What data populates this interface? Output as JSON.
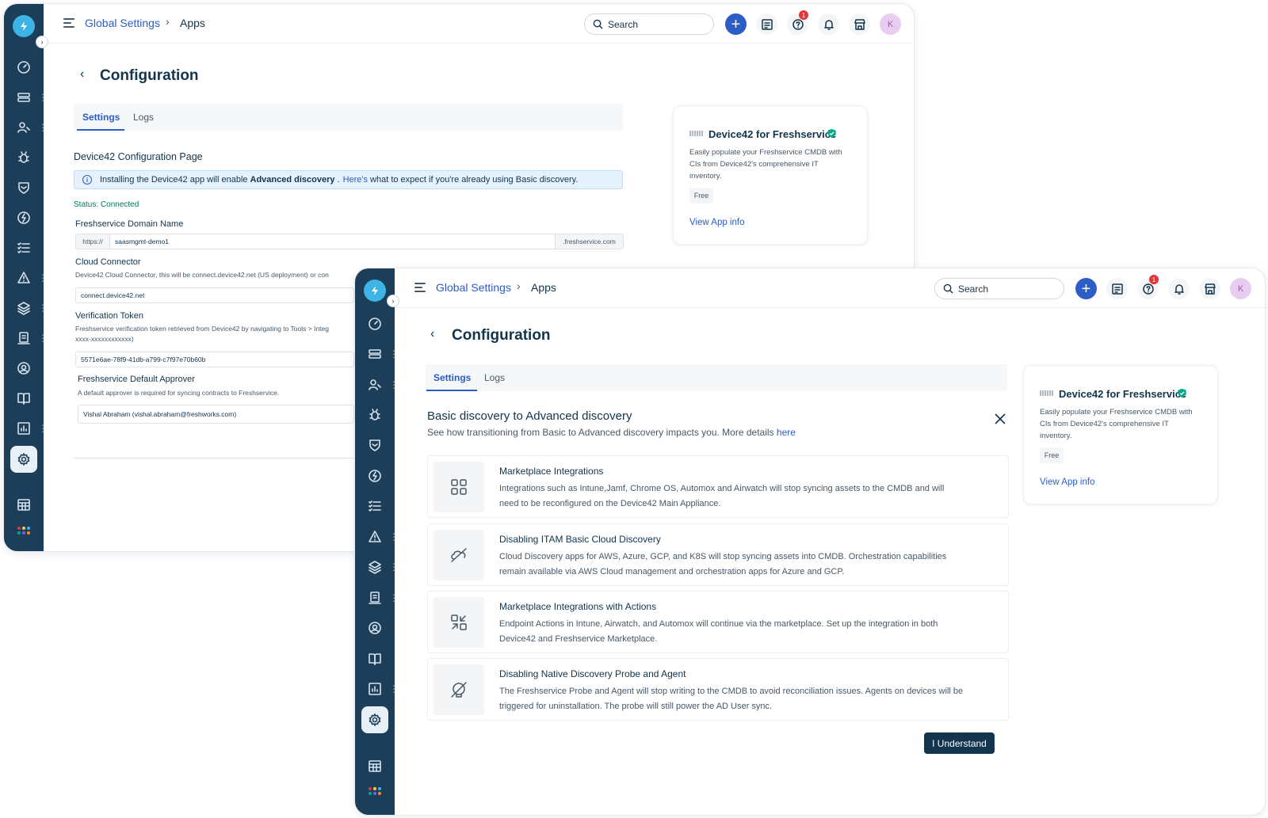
{
  "topbar": {
    "breadcrumb_parent": "Global Settings",
    "breadcrumb_sep": "›",
    "breadcrumb_current": "Apps",
    "search_placeholder": "Search",
    "plus_label": "+",
    "help_badge": "1",
    "avatar_initial": "K"
  },
  "page": {
    "title": "Configuration",
    "back_glyph": "‹"
  },
  "tabs": [
    "Settings",
    "Logs"
  ],
  "app_card": {
    "name": "Device42 for Freshservice",
    "description": "Easily populate your Freshservice CMDB with CIs from Device42's comprehensive IT inventory.",
    "price": "Free",
    "link": "View App info"
  },
  "config_form": {
    "heading": "Device42 Configuration Page",
    "banner_prefix": "Installing the Device42 app will enable",
    "banner_bold": "Advanced discovery",
    "banner_period": ".",
    "banner_link": "Here's",
    "banner_suffix": "what to expect if you're already using Basic discovery.",
    "status": "Status: Connected",
    "domain_label": "Freshservice Domain Name",
    "domain_prefix": "https://",
    "domain_value": "saasmgmt-demo1",
    "domain_suffix": ".freshservice.com",
    "connector_label": "Cloud Connector",
    "connector_help": "Device42 Cloud Connector, this will be connect.device42.net (US deployment) or con",
    "connector_value": "connect.device42.net",
    "token_label": "Verification Token",
    "token_help_line1": "Freshservice verification token retrieved from Device42 by navigating to Tools > Integ",
    "token_help_line2": "xxxx-xxxxxxxxxxxx)",
    "token_value": "5571e6ae-78f9-41db-a799-c7f97e70b60b",
    "approver_label": "Freshservice Default Approver",
    "approver_help": "A default approver is required for syncing contracts to Freshservice.",
    "approver_value": "Vishal Abraham (vishal.abraham@freshworks.com)"
  },
  "modal": {
    "title": "Basic discovery to Advanced discovery",
    "subtitle": "See how transitioning from Basic to Advanced discovery impacts you. More details",
    "subtitle_link": "here",
    "items": [
      {
        "icon": "apps-grid-icon",
        "title": "Marketplace Integrations",
        "desc_line1": "Integrations such as Intune,Jamf, Chrome OS, Automox and Airwatch will stop syncing assets to the CMDB and will",
        "desc_line2": "need to be reconfigured on the Device42 Main Appliance."
      },
      {
        "icon": "cloud-off-icon",
        "title": "Disabling ITAM Basic Cloud Discovery",
        "desc_line1": "Cloud Discovery apps for AWS, Azure, GCP, and K8S will stop syncing assets into CMDB. Orchestration capabilities",
        "desc_line2": "remain available via AWS Cloud management and orchestration apps for Azure and GCP."
      },
      {
        "icon": "actions-icon",
        "title": "Marketplace Integrations with Actions",
        "desc_line1": "Endpoint Actions in Intune, Airwatch, and Automox will continue via the marketplace. Set up the integration in both",
        "desc_line2": "Device42 and Freshservice Marketplace."
      },
      {
        "icon": "probe-off-icon",
        "title": "Disabling Native Discovery Probe and Agent",
        "desc_line1": "The Freshservice Probe and Agent will stop writing to the CMDB to avoid reconciliation issues. Agents on devices will be",
        "desc_line2": "triggered for uninstallation. The probe will still power the AD User sync."
      }
    ],
    "confirm_label": "I Understand"
  },
  "colors": {
    "rail": "#1d3e59",
    "accent": "#2c5cc5",
    "primary_button": "#12344d",
    "status_green": "#00795b"
  }
}
